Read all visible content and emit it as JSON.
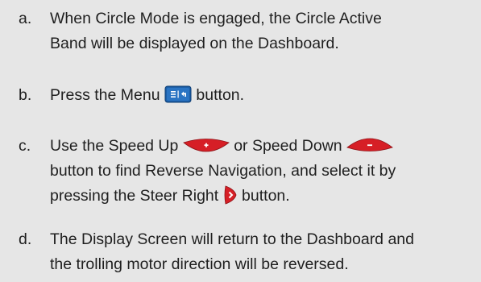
{
  "steps": [
    {
      "marker": "a.",
      "lines": [
        "When Circle Mode is engaged, the Circle Active",
        "Band will be displayed on the Dashboard."
      ]
    },
    {
      "marker": "b.",
      "text_before_icon": "Press the Menu",
      "icon": "menu-button-icon",
      "text_after_icon": "button."
    },
    {
      "marker": "c.",
      "line1_part1": "Use the Speed Up",
      "icon1": "speed-up-button-icon",
      "line1_part2": "or Speed Down",
      "icon2": "speed-down-button-icon",
      "line2": "button to find Reverse Navigation, and select it by",
      "line3_part1": "pressing the Steer Right",
      "icon3": "steer-right-button-icon",
      "line3_part2": "button."
    },
    {
      "marker": "d.",
      "lines": [
        "The Display Screen will return to the Dashboard and",
        "the trolling motor direction will be reversed."
      ]
    }
  ],
  "colors": {
    "background": "#e6e6e6",
    "text": "#1f1f1f",
    "menu_icon_blue": "#1c5fa8",
    "speed_button_red": "#d61f26"
  }
}
